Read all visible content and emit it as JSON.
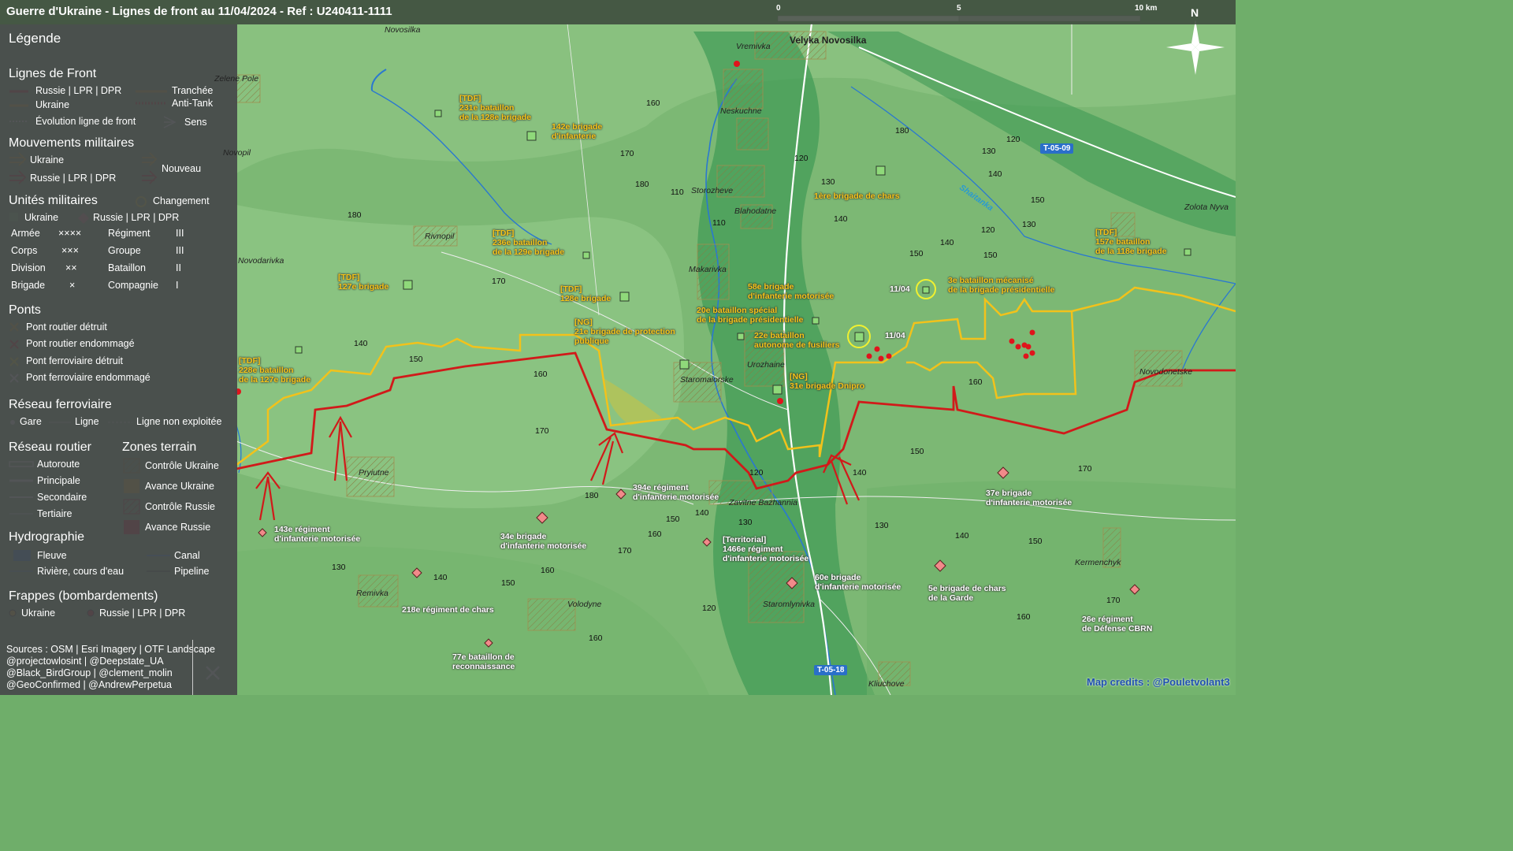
{
  "title": "Guerre d'Ukraine - Lignes de front au 11/04/2024 - Ref : U240411-1111",
  "scale": {
    "zero": "0",
    "mid": "5",
    "end": "10 km"
  },
  "compass": "N",
  "colors": {
    "russia": "#d11a1a",
    "ukraine": "#f2c21b",
    "legend_bg": "#46484a"
  },
  "legend": {
    "title": "Légende",
    "front_lines": {
      "heading": "Lignes de Front",
      "russia": "Russie | LPR | DPR",
      "ukraine": "Ukraine",
      "trench": "Tranchée",
      "antitank": "Anti-Tank",
      "evolution": "Évolution ligne de front",
      "direction": "Sens"
    },
    "movements": {
      "heading": "Mouvements militaires",
      "ukraine": "Ukraine",
      "russia": "Russie | LPR | DPR",
      "new": "Nouveau"
    },
    "units": {
      "heading": "Unités militaires",
      "change": "Changement",
      "ukraine": "Ukraine",
      "russia": "Russie | LPR | DPR",
      "sizes": [
        {
          "name": "Armée",
          "sym": "××××",
          "name2": "Régiment",
          "sym2": "III"
        },
        {
          "name": "Corps",
          "sym": "×××",
          "name2": "Groupe",
          "sym2": "III"
        },
        {
          "name": "Division",
          "sym": "××",
          "name2": "Bataillon",
          "sym2": "II"
        },
        {
          "name": "Brigade",
          "sym": "×",
          "name2": "Compagnie",
          "sym2": "I"
        }
      ]
    },
    "bridges": {
      "heading": "Ponts",
      "items": [
        "Pont routier détruit",
        "Pont routier endommagé",
        "Pont ferroviaire détruit",
        "Pont ferroviaire endommagé"
      ]
    },
    "rail": {
      "heading": "Réseau ferroviaire",
      "station": "Gare",
      "line": "Ligne",
      "unused": "Ligne non exploitée"
    },
    "roads": {
      "heading": "Réseau routier",
      "items": [
        "Autoroute",
        "Principale",
        "Secondaire",
        "Tertiaire"
      ]
    },
    "zones": {
      "heading": "Zones terrain",
      "items": [
        "Contrôle Ukraine",
        "Avance Ukraine",
        "Contrôle Russie",
        "Avance Russie"
      ]
    },
    "hydro": {
      "heading": "Hydrographie",
      "river": "Fleuve",
      "stream": "Rivière, cours d'eau",
      "canal": "Canal",
      "pipeline": "Pipeline"
    },
    "strikes": {
      "heading": "Frappes (bombardements)",
      "ukraine": "Ukraine",
      "russia": "Russie | LPR | DPR"
    }
  },
  "sources": [
    "Sources : OSM | Esri Imagery | OTF Landscape",
    "@projectowlosint | @Deepstate_UA",
    "@Black_BirdGroup | @clement_molin",
    "@GeoConfirmed | @AndrewPerpetua"
  ],
  "credits": "Map credits : @Pouletvolant3",
  "towns": [
    "Novosilka",
    "Velyka Novosilka",
    "Vremivka",
    "Zelene Pole",
    "Neskuchne",
    "Novopil",
    "Storozheve",
    "Blahodatne",
    "Rivnopil",
    "Novodarivka",
    "Makarivka",
    "Urozhaine",
    "Staromaiorske",
    "Pryiutne",
    "Zavitne Bazhannia",
    "Remivka",
    "Volodyne",
    "Staromlynivka",
    "Kliuchove",
    "Kermenchyk",
    "Novodonetske",
    "Zolota Nyva",
    "Shaitanka"
  ],
  "roads_ids": [
    "T-05-09",
    "T-05-18"
  ],
  "date_tags": [
    "11/04",
    "11/04"
  ],
  "units_ua": [
    {
      "pre": "[TDF]",
      "name": "231e bataillon",
      "name2": "de la 128e brigade"
    },
    {
      "pre": "",
      "name": "142e brigade",
      "name2": "d'infanterie"
    },
    {
      "pre": "",
      "name": "1ère brigade de chars",
      "name2": ""
    },
    {
      "pre": "[TDF]",
      "name": "236e bataillon",
      "name2": "de la 129e brigade"
    },
    {
      "pre": "[TDF]",
      "name": "157e bataillon",
      "name2": "de la 118e brigade"
    },
    {
      "pre": "[TDF]",
      "name": "127e brigade",
      "name2": ""
    },
    {
      "pre": "[TDF]",
      "name": "128e brigade",
      "name2": ""
    },
    {
      "pre": "",
      "name": "58e brigade",
      "name2": "d'infanterie motorisée"
    },
    {
      "pre": "",
      "name": "3e bataillon mécanisé",
      "name2": "de la brigade présidentielle"
    },
    {
      "pre": "",
      "name": "20e bataillon spécial",
      "name2": "de la brigade présidentielle"
    },
    {
      "pre": "[NG]",
      "name": "21e brigade de protection",
      "name2": "publique"
    },
    {
      "pre": "",
      "name": "22e bataillon",
      "name2": "autonome de fusiliers"
    },
    {
      "pre": "[TDF]",
      "name": "228e bataillon",
      "name2": "de la 127e brigade"
    },
    {
      "pre": "[NG]",
      "name": "31e brigade Dnipro",
      "name2": ""
    }
  ],
  "units_ru": [
    {
      "name": "394e régiment",
      "name2": "d'infanterie motorisée"
    },
    {
      "name": "37e brigade",
      "name2": "d'infanterie motorisée"
    },
    {
      "name": "143e régiment",
      "name2": "d'infanterie motorisée"
    },
    {
      "name": "34e brigade",
      "name2": "d'infanterie motorisée"
    },
    {
      "name": "[Territorial]",
      "name2": "1466e régiment",
      "name3": "d'infanterie motorisée"
    },
    {
      "name": "60e brigade",
      "name2": "d'infanterie motorisée"
    },
    {
      "name": "5e brigade de chars",
      "name2": "de la Garde"
    },
    {
      "name": "26e régiment",
      "name2": "de Défense CBRN"
    },
    {
      "name": "218e régiment de chars",
      "name2": ""
    },
    {
      "name": "77e bataillon de",
      "name2": "reconnaissance"
    }
  ],
  "elevations": [
    "160",
    "170",
    "180",
    "110",
    "120",
    "130",
    "140",
    "150",
    "120",
    "130",
    "140",
    "150",
    "130",
    "120",
    "140",
    "150",
    "180",
    "110",
    "140",
    "150",
    "170",
    "160",
    "170",
    "160",
    "150",
    "140",
    "180",
    "120",
    "150",
    "160",
    "170",
    "140",
    "130",
    "140",
    "150",
    "160",
    "120",
    "130",
    "160",
    "150",
    "170",
    "130",
    "140",
    "170",
    "160",
    "180"
  ]
}
